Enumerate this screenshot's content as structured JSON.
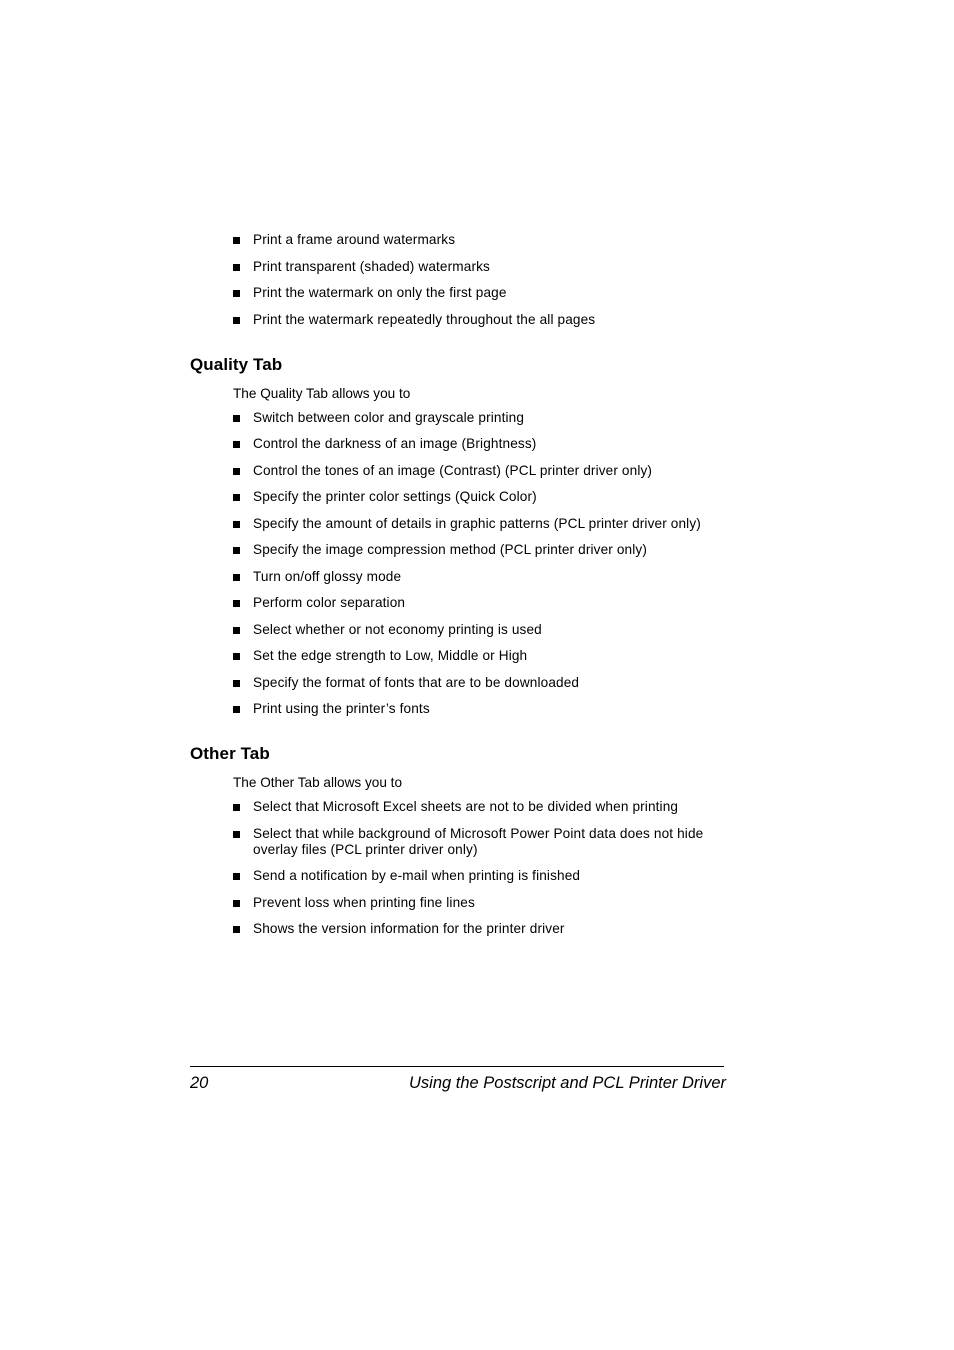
{
  "document": {
    "type": "manual-page",
    "background_color": "#ffffff",
    "text_color": "#000000"
  },
  "top_list": {
    "items": [
      "Print a frame around watermarks",
      "Print transparent (shaded) watermarks",
      "Print the watermark on only the first page",
      "Print the watermark repeatedly throughout the all pages"
    ]
  },
  "sections": [
    {
      "heading": "Quality Tab",
      "intro": "The Quality Tab allows you to",
      "items": [
        "Switch between color and grayscale printing",
        "Control the darkness of an image (Brightness)",
        "Control the tones of an image (Contrast) (PCL printer driver only)",
        "Specify the printer color settings (Quick Color)",
        "Specify the amount of details in graphic patterns (PCL printer driver only)",
        "Specify the image compression method (PCL printer driver only)",
        "Turn on/off glossy mode",
        "Perform color separation",
        "Select whether or not economy printing is used",
        "Set the edge strength to Low, Middle or High",
        "Specify the format of fonts that are to be downloaded",
        "Print using the printer’s fonts"
      ]
    },
    {
      "heading": "Other Tab",
      "intro": "The Other Tab allows you to",
      "items": [
        "Select that Microsoft Excel sheets are not to be divided when printing",
        "Select that while background of Microsoft Power Point data does not hide overlay files (PCL printer driver only)",
        "Send a notification by e-mail when printing is finished",
        "Prevent loss when printing fine lines",
        "Shows the version information for the printer driver"
      ]
    }
  ],
  "footer": {
    "page_number": "20",
    "title": "Using the Postscript and PCL Printer Driver"
  }
}
